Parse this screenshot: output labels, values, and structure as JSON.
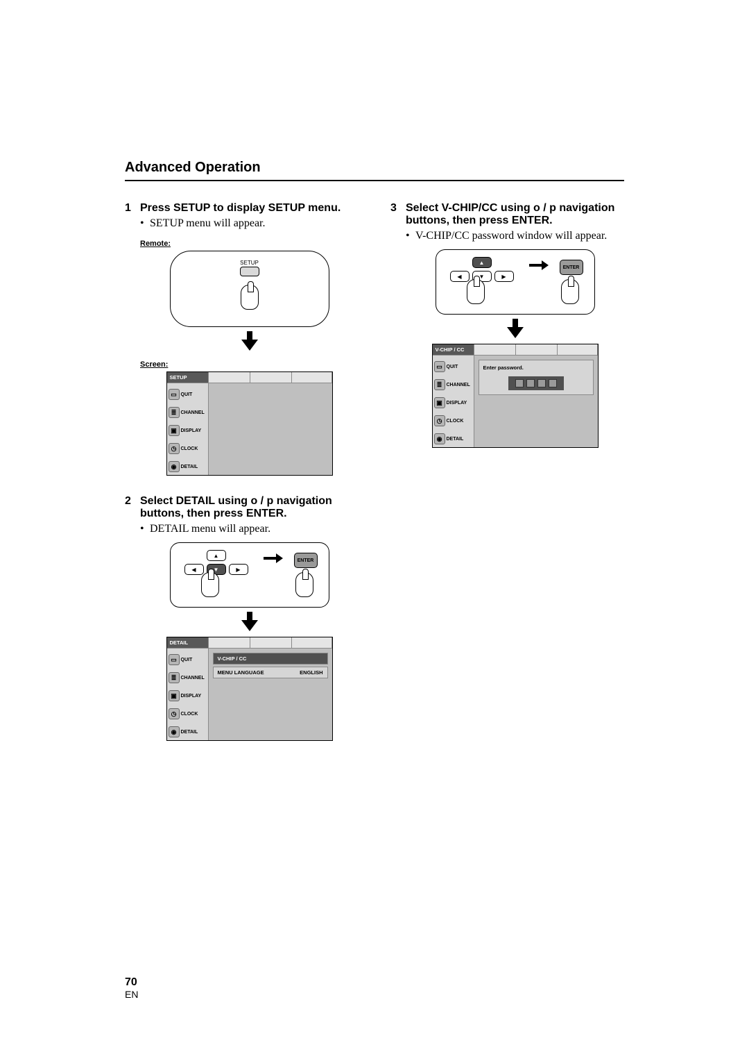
{
  "section_title": "Advanced Operation",
  "step1": {
    "num": "1",
    "heading": "Press SETUP to display SETUP menu.",
    "bullet": "SETUP menu will appear.",
    "remote_label": "Remote:",
    "screen_label": "Screen:",
    "setup_btn_label": "SETUP"
  },
  "screen_common": {
    "menu_items": {
      "quit": "QUIT",
      "channel": "CHANNEL",
      "display": "DISPLAY",
      "clock": "CLOCK",
      "detail": "DETAIL"
    }
  },
  "screen1_tab": "SETUP",
  "step2": {
    "num": "2",
    "heading_a": "Select DETAIL using ",
    "heading_nav": "o / p",
    "heading_b": " navigation buttons, then press ENTER.",
    "bullet": "DETAIL menu will appear.",
    "enter_label": "ENTER"
  },
  "screen2": {
    "tab": "DETAIL",
    "row1_label": "V-CHIP / CC",
    "row2_label": "MENU LANGUAGE",
    "row2_value": "ENGLISH"
  },
  "step3": {
    "num": "3",
    "heading_a": "Select V-CHIP/CC using ",
    "heading_nav": "o / p",
    "heading_b": " navigation buttons, then press ENTER.",
    "bullet": "V-CHIP/CC password window  will appear.",
    "enter_label": "ENTER"
  },
  "screen3": {
    "tab": "V-CHIP / CC",
    "password_prompt": "Enter password."
  },
  "nav_glyphs": {
    "up": "▲",
    "down": "▼",
    "left": "◀",
    "right": "▶"
  },
  "footer": {
    "page": "70",
    "lang": "EN"
  }
}
